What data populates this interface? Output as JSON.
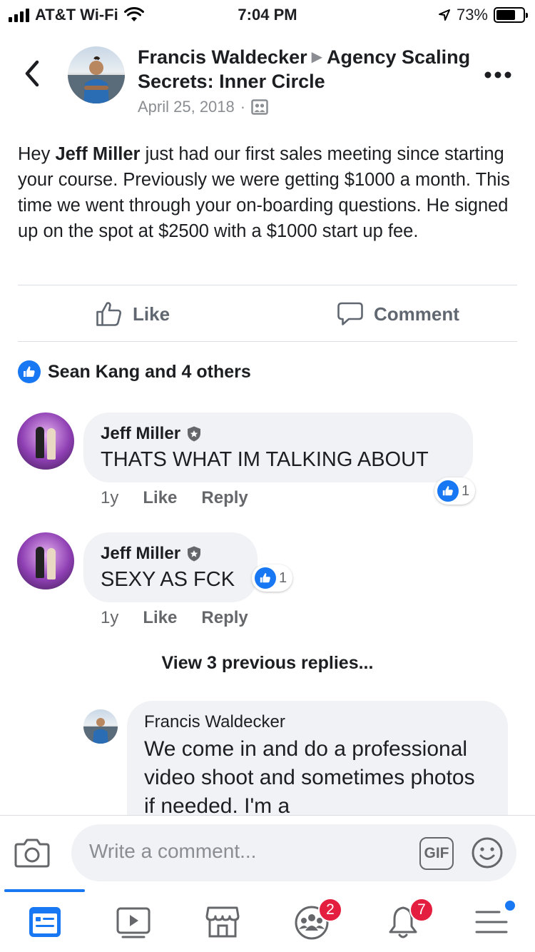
{
  "status_bar": {
    "carrier": "AT&T Wi-Fi",
    "time": "7:04 PM",
    "battery_percent": "73%",
    "battery_level": 0.73
  },
  "header": {
    "author": "Francis Waldecker",
    "group": "Agency Scaling Secrets: Inner Circle",
    "date": "April 25, 2018",
    "separator": "·"
  },
  "post": {
    "text_before": "Hey ",
    "mention": "Jeff Miller",
    "text_after": " just had our first sales meeting since starting your course. Previously we were getting $1000 a month. This time we went through your on-boarding questions. He signed up on the spot at $2500 with a $1000 start up fee."
  },
  "actions": {
    "like_label": "Like",
    "comment_label": "Comment"
  },
  "reactions": {
    "summary": "Sean Kang and 4 others"
  },
  "comments": [
    {
      "author": "Jeff Miller",
      "text": "THATS WHAT IM TALKING ABOUT",
      "time": "1y",
      "like_label": "Like",
      "reply_label": "Reply",
      "reaction_count": "1"
    },
    {
      "author": "Jeff Miller",
      "text": "SEXY AS FCK",
      "time": "1y",
      "like_label": "Like",
      "reply_label": "Reply",
      "reaction_count": "1"
    }
  ],
  "view_previous": "View 3 previous replies...",
  "reply": {
    "author": "Francis Waldecker",
    "text": "We come in and do a professional video shoot and sometimes photos if needed. I'm a"
  },
  "composer": {
    "placeholder": "Write a comment...",
    "gif_label": "GIF"
  },
  "tab_bar": {
    "groups_badge": "2",
    "notifications_badge": "7"
  },
  "colors": {
    "accent": "#1877f2",
    "badge": "#e41e3f",
    "bubble": "#f0f2f5",
    "muted": "#65676b"
  }
}
